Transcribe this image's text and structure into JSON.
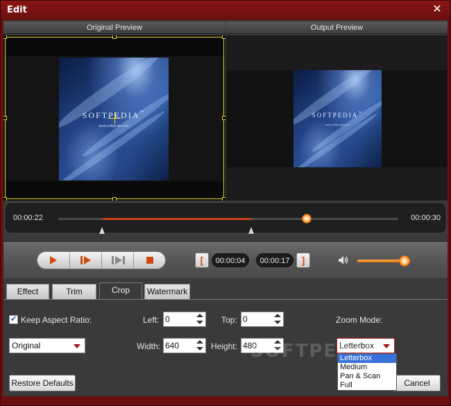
{
  "window": {
    "title": "Edit"
  },
  "preview": {
    "original_label": "Original Preview",
    "output_label": "Output Preview",
    "art_title": "SOFTPEDIA",
    "art_trademark": "™",
    "art_subtitle": "www.softpedia.com"
  },
  "timeline": {
    "current_time": "00:00:22",
    "total_time": "00:00:30",
    "selection_start_fraction": 0.13,
    "selection_end_fraction": 0.57,
    "playhead_fraction": 0.73
  },
  "controls": {
    "start_time": "00:00:04",
    "end_time": "00:00:17",
    "left_bracket": "[",
    "right_bracket": "]",
    "volume_fraction": 0.9
  },
  "tabs": [
    {
      "label": "Effect"
    },
    {
      "label": "Trim"
    },
    {
      "label": "Crop"
    },
    {
      "label": "Watermark"
    }
  ],
  "crop": {
    "keep_aspect_label": "Keep Aspect Ratio:",
    "keep_aspect_checked": true,
    "aspect_value": "Original",
    "left_label": "Left:",
    "left_value": "0",
    "top_label": "Top:",
    "top_value": "0",
    "width_label": "Width:",
    "width_value": "640",
    "height_label": "Height:",
    "height_value": "480",
    "zoom_label": "Zoom Mode:",
    "zoom_value": "Letterbox",
    "zoom_options": [
      "Letterbox",
      "Medium",
      "Pan & Scan",
      "Full"
    ]
  },
  "buttons": {
    "restore_defaults": "Restore Defaults",
    "cancel": "Cancel"
  },
  "watermark_text": "SOFTPEDIA",
  "colors": {
    "accent": "#d04a10",
    "titlebar": "#7a1212",
    "selection": "#3872d8"
  }
}
